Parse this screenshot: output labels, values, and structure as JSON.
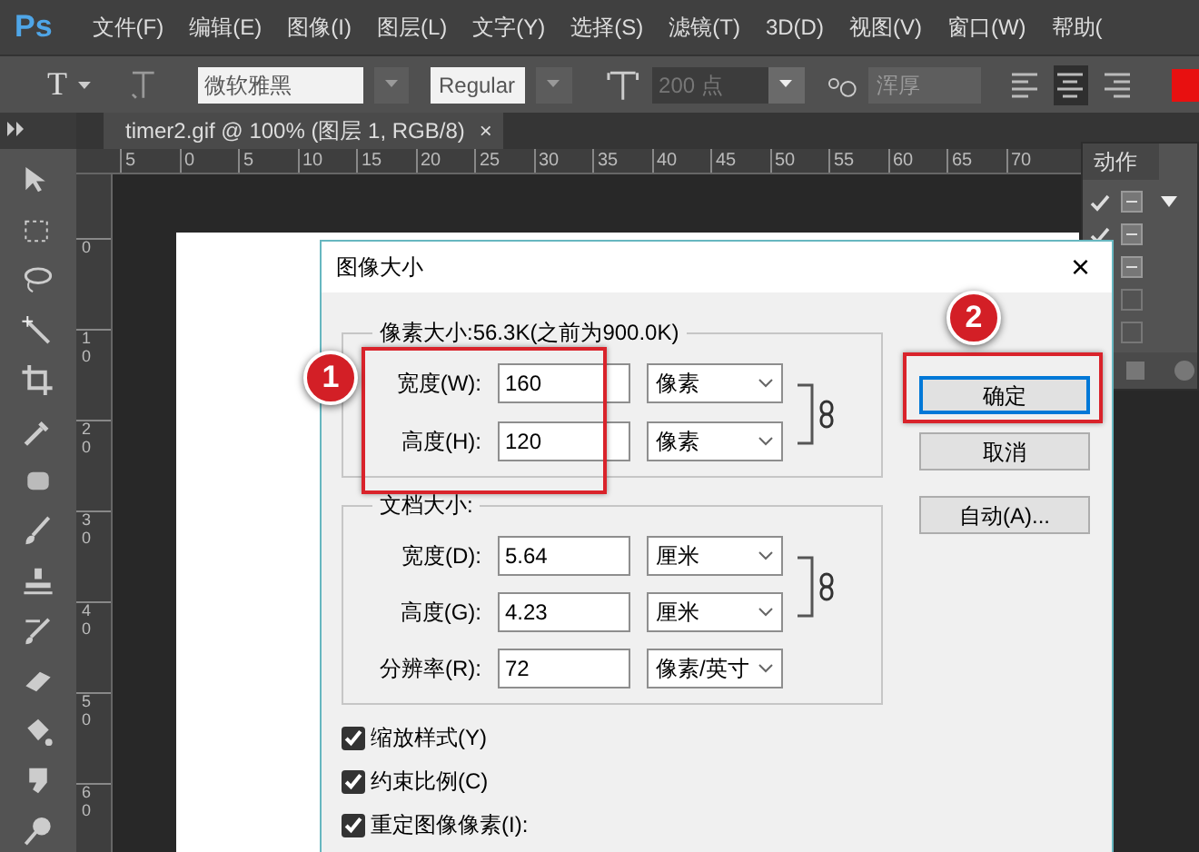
{
  "app": {
    "logo": "Ps"
  },
  "menu": [
    {
      "label": "文件(F)"
    },
    {
      "label": "编辑(E)"
    },
    {
      "label": "图像(I)"
    },
    {
      "label": "图层(L)"
    },
    {
      "label": "文字(Y)"
    },
    {
      "label": "选择(S)"
    },
    {
      "label": "滤镜(T)"
    },
    {
      "label": "3D(D)"
    },
    {
      "label": "视图(V)"
    },
    {
      "label": "窗口(W)"
    },
    {
      "label": "帮助("
    }
  ],
  "options_bar": {
    "tool_glyph": "T",
    "font_family": "微软雅黑",
    "font_style": "Regular",
    "font_size": "200 点",
    "antialias": "浑厚",
    "align": [
      {
        "kind": "left",
        "selected": false
      },
      {
        "kind": "center",
        "selected": true
      },
      {
        "kind": "right",
        "selected": false
      }
    ]
  },
  "document_tab": {
    "title": "timer2.gif @ 100% (图层 1, RGB/8)",
    "close": "×"
  },
  "ruler": {
    "horizontal": [
      "5",
      "0",
      "5",
      "10",
      "15",
      "20",
      "25",
      "30",
      "35",
      "40",
      "45",
      "50",
      "55",
      "60",
      "65",
      "70"
    ],
    "vertical": [
      "0",
      "10",
      "20",
      "30",
      "40",
      "50",
      "60"
    ]
  },
  "actions_panel": {
    "tab": "动作",
    "rows": [
      {
        "checked": true,
        "dialog_toggle": true
      },
      {
        "checked": true,
        "dialog_toggle": true
      },
      {
        "dialog_toggle": true
      },
      {
        "dialog_toggle": false
      },
      {
        "dialog_toggle": false
      }
    ]
  },
  "dialog": {
    "title": "图像大小",
    "close": "×",
    "pixel_size": {
      "legend": "像素大小:56.3K(之前为900.0K)",
      "rows": [
        {
          "label": "宽度(W):",
          "value": "160",
          "unit": "像素"
        },
        {
          "label": "高度(H):",
          "value": "120",
          "unit": "像素"
        }
      ]
    },
    "document_size": {
      "legend": "文档大小:",
      "rows": [
        {
          "label": "宽度(D):",
          "value": "5.64",
          "unit": "厘米"
        },
        {
          "label": "高度(G):",
          "value": "4.23",
          "unit": "厘米"
        },
        {
          "label": "分辨率(R):",
          "value": "72",
          "unit": "像素/英寸"
        }
      ]
    },
    "checkboxes": [
      {
        "label": "缩放样式(Y)",
        "checked": true
      },
      {
        "label": "约束比例(C)",
        "checked": true
      },
      {
        "label": "重定图像像素(I):",
        "checked": true
      }
    ],
    "buttons": [
      {
        "label": "确定",
        "default": true
      },
      {
        "label": "取消",
        "default": false
      },
      {
        "label": "自动(A)...",
        "default": false
      }
    ]
  },
  "annotations": [
    {
      "number": "1",
      "kind": "fields"
    },
    {
      "number": "2",
      "kind": "button"
    }
  ]
}
